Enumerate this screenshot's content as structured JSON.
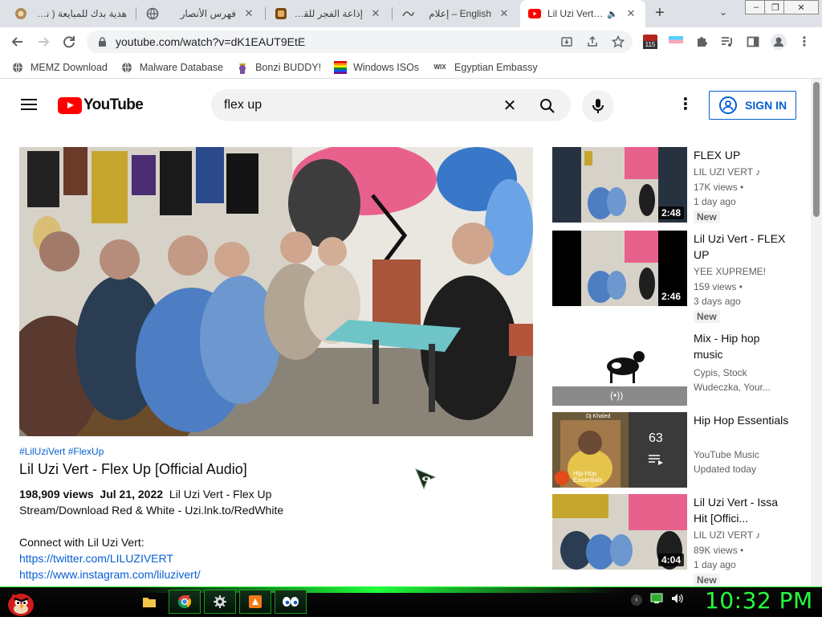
{
  "browser": {
    "tabs": [
      {
        "title": "هدية بدك للمبايعة ( نشيد",
        "favicon": "badge-icon"
      },
      {
        "title": "فهرس الأنصار",
        "favicon": "globe-icon"
      },
      {
        "title": "إذاعة الفجر للقرآن الكري",
        "favicon": "quran-icon"
      },
      {
        "title": "English – إعلام",
        "favicon": "site-icon"
      },
      {
        "title": "Lil Uzi Vert - F",
        "favicon": "youtube-icon",
        "active": true
      }
    ],
    "new_tab_label": "+",
    "url": "youtube.com/watch?v=dK1EAUT9EtE",
    "extension_badge": "115",
    "bookmarks": [
      {
        "label": "MEMZ Download",
        "icon": "globe-icon"
      },
      {
        "label": "Malware Database",
        "icon": "globe-icon"
      },
      {
        "label": "Bonzi BUDDY!",
        "icon": "bonzi-icon"
      },
      {
        "label": "Windows ISOs",
        "icon": "windows-icon"
      },
      {
        "label": "Egyptian Embassy",
        "icon": "wix-icon"
      }
    ],
    "wix_text": "WIX"
  },
  "youtube": {
    "logo_text": "YouTube",
    "search_query": "flex up",
    "signin_label": "SIGN IN",
    "video": {
      "hashtags": "#LilUziVert #FlexUp",
      "title": "Lil Uzi Vert - Flex Up [Official Audio]",
      "views": "198,909 views",
      "date": "Jul 21, 2022",
      "desc_inline": "Lil Uzi Vert - Flex Up",
      "desc_line2": "Stream/Download Red & White - Uzi.lnk.to/RedWhite",
      "desc_line3": "Connect with Lil Uzi Vert:",
      "link1": "https://twitter.com/LILUZIVERT",
      "link2": "https://www.instagram.com/liluzivert/"
    },
    "recommendations": [
      {
        "title": "FLEX UP",
        "channel": "LIL UZI VERT ♪",
        "views": "17K views •",
        "age": "1 day ago",
        "badge": "New",
        "duration": "2:48",
        "thumb": "studio"
      },
      {
        "title": "Lil Uzi Vert - FLEX UP",
        "channel": "YEE XUPREME!",
        "views": "159 views •",
        "age": "3 days ago",
        "badge": "New",
        "duration": "2:46",
        "thumb": "studio-letterbox"
      },
      {
        "title": "Mix - Hip hop music",
        "channel": "Cypis, Stock",
        "views": "Wudeczka, Your...",
        "age": "",
        "badge": "",
        "duration": "",
        "thumb": "mix",
        "live_icon": "(•))"
      },
      {
        "title": "Hip Hop Essentials",
        "channel": "YouTube Music",
        "views": "Updated today",
        "age": "",
        "badge": "",
        "duration": "",
        "thumb": "playlist",
        "playlist_count": "63",
        "playlist_label_top": "Hip-Hop",
        "playlist_label_bottom": "Essentials",
        "thumb_tag": "Dj Khaled"
      },
      {
        "title": "Lil Uzi Vert - Issa Hit [Offici...",
        "channel": "LIL UZI VERT ♪",
        "views": "89K views •",
        "age": "1 day ago",
        "badge": "New",
        "duration": "4:04",
        "thumb": "studio"
      }
    ]
  },
  "taskbar": {
    "clock": "10:32 PM",
    "accent": "#26ff3b"
  }
}
